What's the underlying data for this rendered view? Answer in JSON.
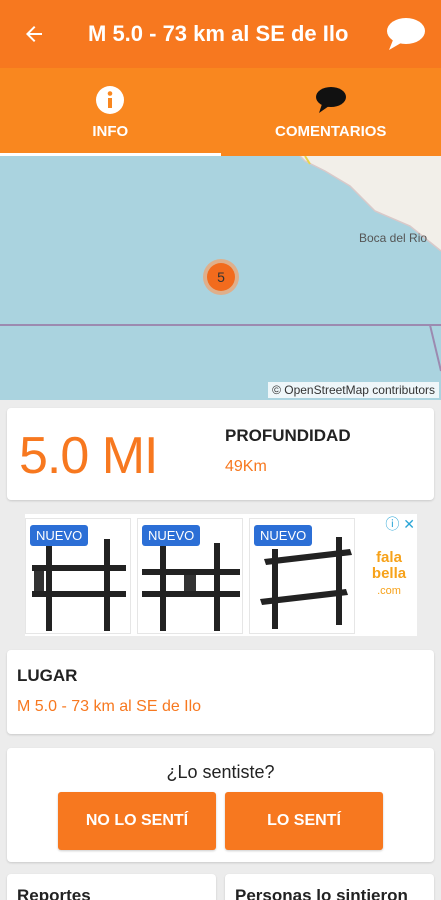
{
  "appbar": {
    "title": "M 5.0 - 73 km al SE de Ilo",
    "back_icon": "arrow-left-icon",
    "chat_icon": "chat-bubble-icon",
    "color": "#f7781f"
  },
  "tabs": [
    {
      "label": "INFO",
      "icon": "info-icon",
      "active": true
    },
    {
      "label": "COMENTARIOS",
      "icon": "speech-bubble-icon",
      "active": false
    }
  ],
  "map": {
    "place_label": "Boca del Rio",
    "cluster_count": "5",
    "attribution": "© OpenStreetMap contributors"
  },
  "magnitude": {
    "value": "5.0 MI",
    "depth_label": "PROFUNDIDAD",
    "depth_value": "49Km"
  },
  "ad": {
    "badges": [
      "NUEVO",
      "NUEVO",
      "NUEVO"
    ],
    "brand_line1": "fala",
    "brand_line2": "bella",
    "brand_line3": ".com"
  },
  "place": {
    "label": "LUGAR",
    "value": "M 5.0 - 73 km al SE de Ilo"
  },
  "felt": {
    "question": "¿Lo sentiste?",
    "no_label": "NO LO SENTÍ",
    "yes_label": "LO SENTÍ"
  },
  "bottom_cards": {
    "reports_label": "Reportes",
    "people_label": "Personas lo sintieron"
  }
}
